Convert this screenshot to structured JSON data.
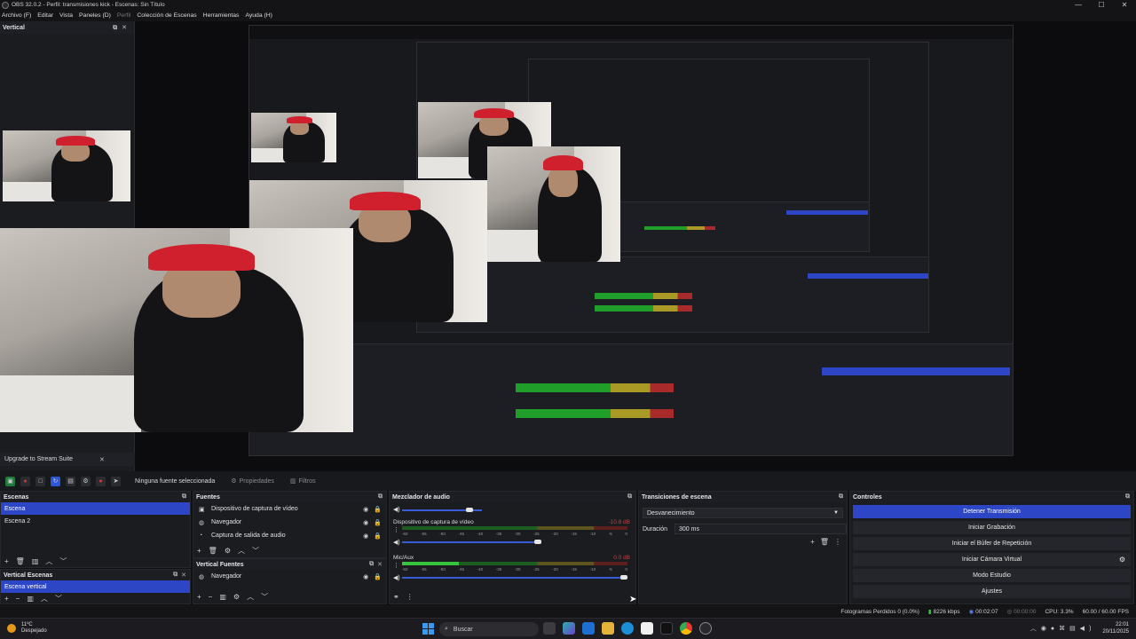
{
  "window": {
    "title": "OBS 32.0.2 - Perfil: transmisiones kick - Escenas: Sin Título",
    "minimize": "—",
    "maximize": "☐",
    "close": "✕"
  },
  "menu": [
    "Archivo (F)",
    "Editar",
    "Vista",
    "Paneles (D)",
    "Perfil",
    "Colección de Escenas",
    "Herramientas",
    "Ayuda (H)"
  ],
  "vertical_preview": {
    "title": "Vertical"
  },
  "upgrade_banner": {
    "label": "Upgrade to Stream Suite",
    "close": "✕"
  },
  "preview_toolbar": {
    "no_source": "Ninguna fuente seleccionada",
    "properties": "Propiedades",
    "filters": "Filtros"
  },
  "scenes": {
    "title": "Escenas",
    "items": [
      "Escena",
      "Escena 2"
    ],
    "selected": "Escena"
  },
  "vertical_scenes": {
    "title": "Vertical Escenas",
    "items": [
      "Escena vertical"
    ]
  },
  "sources": {
    "title": "Fuentes",
    "items": [
      "Dispositivo de captura de vídeo",
      "Navegador",
      "Captura de salida de audio"
    ]
  },
  "vertical_sources": {
    "title": "Vertical Fuentes",
    "items": [
      "Navegador"
    ]
  },
  "mixer": {
    "title": "Mezclador de audio",
    "scale": [
      "-60",
      "-55",
      "-50",
      "-45",
      "-40",
      "-35",
      "-30",
      "-25",
      "-20",
      "-15",
      "-10",
      "-5",
      "0"
    ],
    "tracks": [
      {
        "name": "Dispositivo de captura de vídeo",
        "db": "-10.8 dB",
        "level": 0.0,
        "volume": 0.62
      },
      {
        "name": "Mic/Aux",
        "db": "0.0 dB",
        "level": 0.25,
        "volume": 1.0
      }
    ]
  },
  "transitions": {
    "title": "Transiciones de escena",
    "selected": "Desvanecimiento",
    "duration_label": "Duración",
    "duration_value": "300 ms"
  },
  "controls": {
    "title": "Controles",
    "buttons": [
      "Detener Transmisión",
      "Iniciar Grabación",
      "Iniciar el Búfer de Repetición",
      "Iniciar Cámara Virtual",
      "Modo Estudio",
      "Ajustes"
    ]
  },
  "status": {
    "dropped_frames": "Fotogramas Perdidos 0 (0.0%)",
    "bitrate": "8226 kbps",
    "stream_time": "00:02:07",
    "rec_time": "00:00:00",
    "cpu": "CPU: 3.3%",
    "fps": "60.00 / 60.00 FPS"
  },
  "taskbar": {
    "weather_temp": "11ºC",
    "weather_desc": "Despejado",
    "search": "Buscar",
    "time": "22:01",
    "date": "20/11/2025"
  },
  "colors": {
    "accent": "#2d46c5",
    "meter_green": "#38c43f",
    "meter_yellow": "#a89a25",
    "meter_red": "#a82a2a"
  }
}
